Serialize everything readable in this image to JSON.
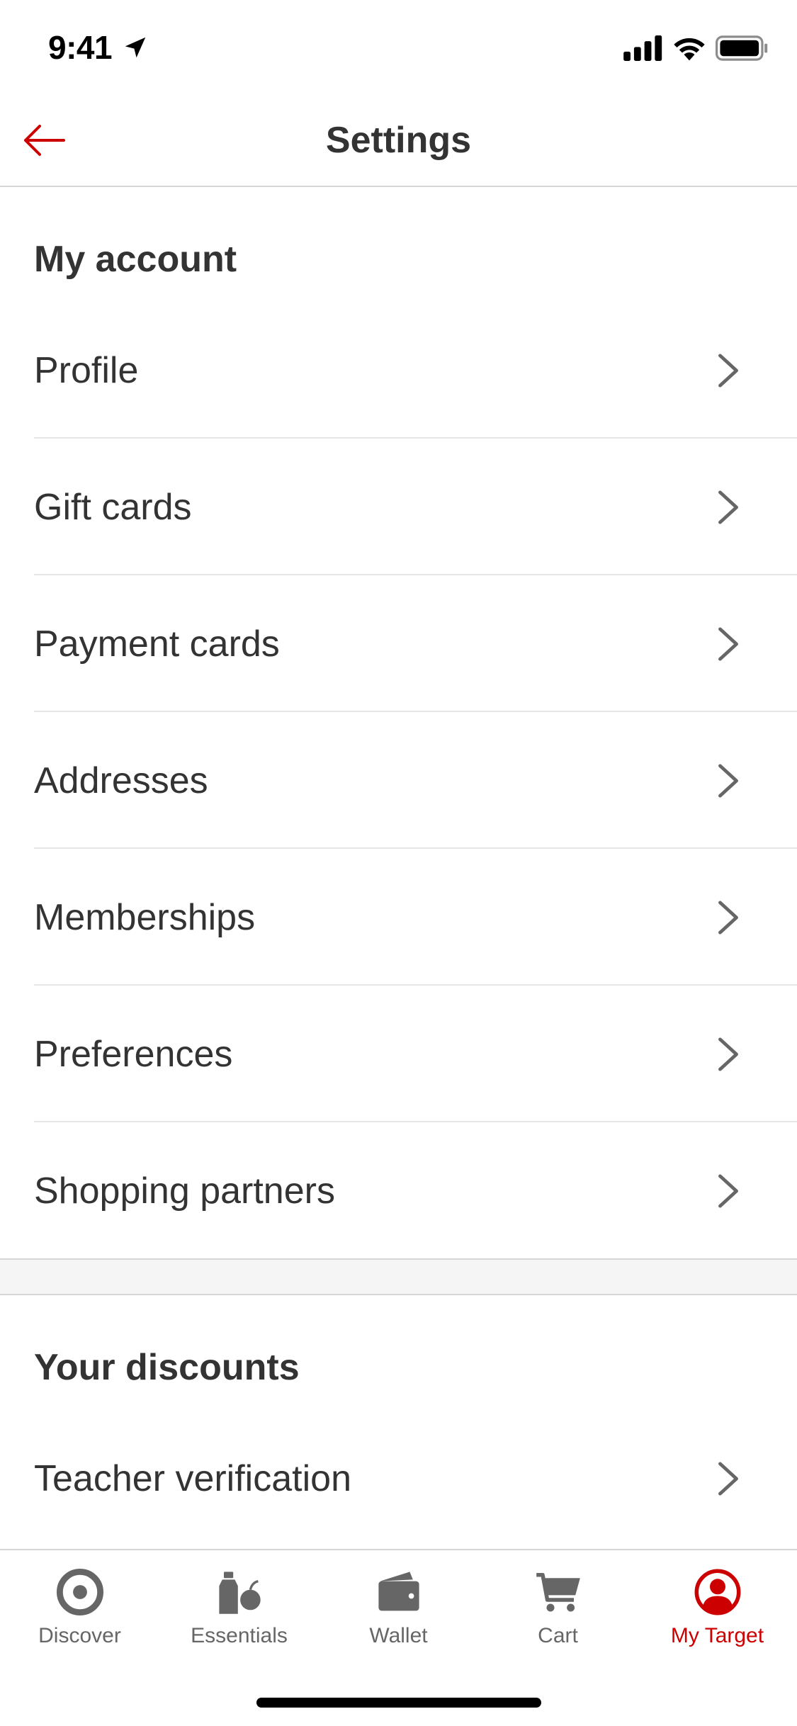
{
  "status_bar": {
    "time": "9:41",
    "icons": [
      "location-arrow-icon",
      "cellular-signal-icon",
      "wifi-icon",
      "battery-icon"
    ]
  },
  "header": {
    "title": "Settings",
    "back_icon": "arrow-left-icon"
  },
  "sections": [
    {
      "heading": "My account",
      "items": [
        {
          "label": "Profile"
        },
        {
          "label": "Gift cards"
        },
        {
          "label": "Payment cards"
        },
        {
          "label": "Addresses"
        },
        {
          "label": "Memberships"
        },
        {
          "label": "Preferences"
        },
        {
          "label": "Shopping partners"
        }
      ]
    },
    {
      "heading": "Your discounts",
      "items": [
        {
          "label": "Teacher verification"
        }
      ]
    }
  ],
  "tab_bar": {
    "active": "My Target",
    "tabs": [
      {
        "label": "Discover",
        "icon": "target-bullseye-icon"
      },
      {
        "label": "Essentials",
        "icon": "essentials-icon"
      },
      {
        "label": "Wallet",
        "icon": "wallet-icon"
      },
      {
        "label": "Cart",
        "icon": "cart-icon"
      },
      {
        "label": "My Target",
        "icon": "account-icon"
      }
    ]
  },
  "colors": {
    "accent": "#cc0000",
    "text": "#333333",
    "muted": "#666666",
    "divider": "#e6e6e6"
  }
}
